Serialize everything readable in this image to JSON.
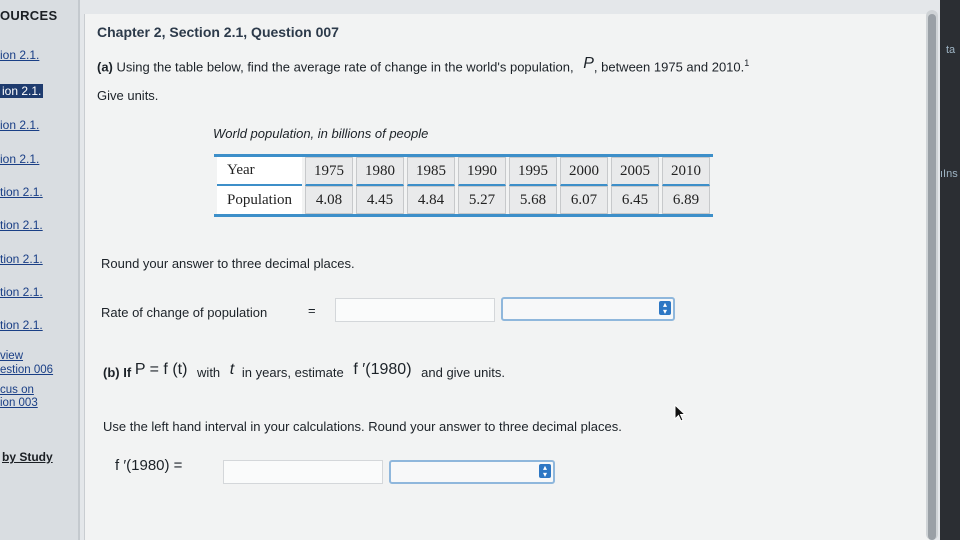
{
  "sidebar": {
    "heading": "OURCES",
    "items": [
      {
        "label": "ion 2.1.",
        "active": false
      },
      {
        "label": "ion 2.1.",
        "active": true
      },
      {
        "label": "ion 2.1.",
        "active": false
      },
      {
        "label": "ion 2.1.",
        "active": false
      },
      {
        "label": "tion 2.1.",
        "active": false
      },
      {
        "label": "tion 2.1.",
        "active": false
      },
      {
        "label": "tion 2.1.",
        "active": false
      },
      {
        "label": "tion 2.1.",
        "active": false
      },
      {
        "label": "tion 2.1.",
        "active": false
      }
    ],
    "extra_links": [
      "view",
      "estion 006",
      "cus on",
      "ion 003"
    ],
    "study_link": "by Study"
  },
  "main": {
    "title": "Chapter 2, Section 2.1, Question 007",
    "part_a": {
      "label": "(a)",
      "text_before": "Using the table below, find the average rate of change in the world's population,",
      "var_P": "P",
      "text_after": ", between 1975 and 2010.",
      "footnote": "1",
      "give_units": "Give units.",
      "caption": "World population, in billions of people",
      "round_note": "Round your answer to three decimal places.",
      "answer_label": "Rate of change of population",
      "equals": "=",
      "answer_value": "",
      "units_value": ""
    },
    "table": {
      "row1_header": "Year",
      "row2_header": "Population",
      "years": [
        "1975",
        "1980",
        "1985",
        "1990",
        "1995",
        "2000",
        "2005",
        "2010"
      ],
      "population": [
        "4.08",
        "4.45",
        "4.84",
        "5.27",
        "5.68",
        "6.07",
        "6.45",
        "6.89"
      ]
    },
    "part_b": {
      "label": "(b)",
      "if": "If",
      "eq": "P = f (t)",
      "with": "with",
      "t": "t",
      "in_years": "in years, estimate",
      "fprime": "f ′(1980)",
      "give_units": "and give units.",
      "instruction": "Use the left hand interval in your calculations. Round your answer to three decimal places.",
      "answer_label": "f ′(1980) =",
      "answer_value": "",
      "units_value": ""
    }
  },
  "edge": {
    "top": "ta",
    "mid": "ıIns"
  }
}
